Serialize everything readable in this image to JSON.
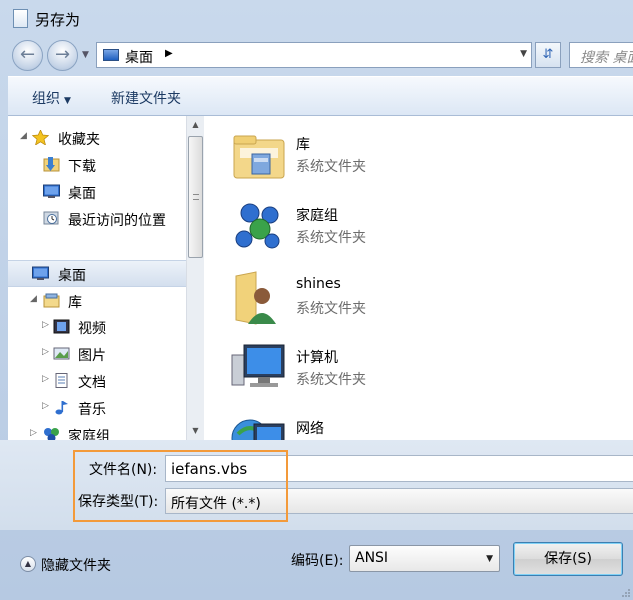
{
  "window": {
    "title": "另存为"
  },
  "address": {
    "location": "桌面",
    "search_placeholder": "搜索 桌面"
  },
  "toolbar": {
    "organize": "组织",
    "new_folder": "新建文件夹"
  },
  "nav_tree": [
    {
      "label": "收藏夹",
      "icon": "star-icon"
    },
    {
      "label": "下载",
      "icon": "download-folder-icon"
    },
    {
      "label": "桌面",
      "icon": "desktop-icon"
    },
    {
      "label": "最近访问的位置",
      "icon": "recent-places-icon"
    },
    {
      "label": "桌面",
      "icon": "desktop-icon"
    },
    {
      "label": "库",
      "icon": "library-icon"
    },
    {
      "label": "视频",
      "icon": "videos-icon"
    },
    {
      "label": "图片",
      "icon": "pictures-icon"
    },
    {
      "label": "文档",
      "icon": "documents-icon"
    },
    {
      "label": "音乐",
      "icon": "music-icon"
    },
    {
      "label": "家庭组",
      "icon": "homegroup-icon"
    }
  ],
  "items": [
    {
      "name": "库",
      "type": "系统文件夹",
      "icon": "library-folder-icon"
    },
    {
      "name": "家庭组",
      "type": "系统文件夹",
      "icon": "homegroup-icon"
    },
    {
      "name": "shines",
      "type": "系统文件夹",
      "icon": "user-folder-icon"
    },
    {
      "name": "计算机",
      "type": "系统文件夹",
      "icon": "computer-icon"
    },
    {
      "name": "网络",
      "type": "",
      "icon": "network-icon"
    }
  ],
  "fields": {
    "filename_label": "文件名(N):",
    "filename_value": "iefans.vbs",
    "filetype_label": "保存类型(T):",
    "filetype_value": "所有文件  (*.*)"
  },
  "footer": {
    "hide_folders": "隐藏文件夹",
    "encoding_label": "编码(E):",
    "encoding_value": "ANSI",
    "save_button": "保存(S)"
  },
  "colors": {
    "highlight_border": "#f39a3a",
    "chrome": "#c9d9ec"
  }
}
